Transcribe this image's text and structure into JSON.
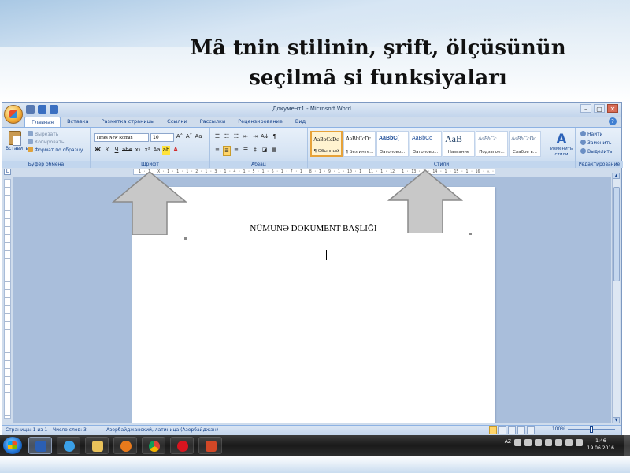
{
  "slide": {
    "title": "Mȃ tnin stilinin, şrift, ölçüsünün seçilmȃ si funksiyaları"
  },
  "word": {
    "window_title": "Документ1 - Microsoft Word",
    "controls": {
      "minimize": "–",
      "maximize": "▢",
      "close": "✕"
    },
    "tabs": [
      "Главная",
      "Вставка",
      "Разметка страницы",
      "Ссылки",
      "Рассылки",
      "Рецензирование",
      "Вид"
    ],
    "clipboard": {
      "paste": "Вставить",
      "cut": "Вырезать",
      "copy": "Копировать",
      "format_painter": "Формат по образцу",
      "group_label": "Буфер обмена"
    },
    "font": {
      "name": "Times New Roman",
      "size": "10",
      "grow": "A˄",
      "shrink": "A˅",
      "clear": "Aa",
      "bold": "Ж",
      "italic": "К",
      "underline": "Ч",
      "strike": "abe",
      "subscript": "x₂",
      "superscript": "x²",
      "case": "Aa",
      "highlight": "ab",
      "color": "A",
      "group_label": "Шрифт"
    },
    "paragraph": {
      "bullets": "☰",
      "numbering": "☷",
      "multilevel": "☵",
      "decrease_indent": "⇤",
      "increase_indent": "⇥",
      "sort": "A↓",
      "pilcrow": "¶",
      "align_left": "≡",
      "center": "≣",
      "align_right": "≡",
      "justify": "☰",
      "spacing": "‡",
      "shading": "◪",
      "borders": "▦",
      "group_label": "Абзац"
    },
    "styles": {
      "items": [
        {
          "sample": "AaBbCcDc",
          "name": "¶ Обычный"
        },
        {
          "sample": "AaBbCcDc",
          "name": "¶ Без инте..."
        },
        {
          "sample": "AaBbC(",
          "name": "Заголово..."
        },
        {
          "sample": "AaBbCc",
          "name": "Заголово..."
        },
        {
          "sample": "AaB",
          "name": "Название"
        },
        {
          "sample": "AaBbCc.",
          "name": "Подзагол..."
        },
        {
          "sample": "AaBbCcDc",
          "name": "Слабое в..."
        }
      ],
      "change_styles": "Изменить стили",
      "group_label": "Стили"
    },
    "editing": {
      "find": "Найти",
      "replace": "Заменить",
      "select": "Выделить",
      "group_label": "Редактирование"
    },
    "ruler_text": "· 1 · 1 · X · 1 · 1 · 1 · 2 · 1 · 3 · 1 · 4 · 1 · 5 · 1 · 6 · 1 · 7 · 1 · 8 · 1 · 9 · 1 · 10 · 1 · 11 · 1 · 12 · 1 · 13 · 1 · 14 · 1 · 15 · 1 · 16 · △ · 17 ·",
    "document": {
      "heading": "NÜMUNƏ DOKUMENT BAŞLIĞI"
    },
    "status": {
      "page": "Страница: 1 из 1",
      "words": "Число слов: 3",
      "language": "Азербайджанский, латиница (Азербайджан)",
      "zoom": "100%"
    }
  },
  "taskbar": {
    "language": "AZ",
    "time": "1:46",
    "date": "19.06.2016"
  },
  "colors": {
    "ribbon": "#d5e3f3",
    "arrow_fill": "#c8c8c8",
    "taskbar": "#1a1a1a"
  },
  "icons": [
    "office-button-icon",
    "save-icon",
    "undo-icon",
    "redo-icon",
    "help-icon",
    "paste-icon",
    "scissors-icon",
    "copy-icon",
    "format-painter-icon",
    "change-styles-icon",
    "find-icon",
    "replace-icon",
    "select-icon",
    "windows-start-icon",
    "word-icon",
    "ie-icon",
    "folder-icon",
    "media-icon",
    "chrome-icon",
    "opera-icon",
    "powerpoint-icon"
  ]
}
